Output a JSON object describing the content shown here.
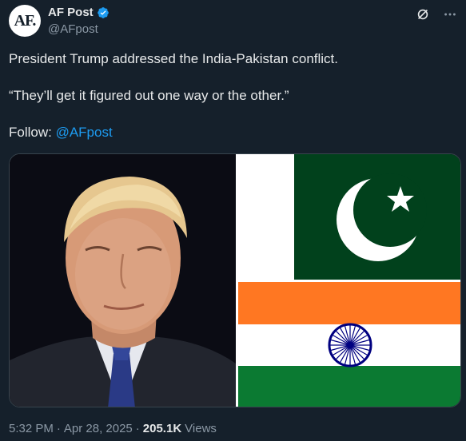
{
  "author": {
    "avatar_text": "AF.",
    "display_name": "AF Post",
    "handle": "@AFpost"
  },
  "tweet": {
    "line1": "President Trump addressed the India-Pakistan conflict.",
    "line2": "“They’ll get it figured out one way or the other.”",
    "follow_label": "Follow: ",
    "follow_mention": "@AFpost"
  },
  "meta": {
    "time": "5:32 PM",
    "separator": "·",
    "date": "Apr 28, 2025",
    "views_count": "205.1K",
    "views_label": "Views"
  },
  "colors": {
    "background": "#15202b",
    "link": "#1d9bf0",
    "verified": "#1d9bf0",
    "pakistan_green": "#01411c",
    "india_saffron": "#ff7722",
    "india_green": "#0b7a32",
    "chakra_blue": "#000080"
  },
  "icons": {
    "verified": "verified-badge-icon",
    "grok": "grok-icon",
    "more": "more-options-icon"
  }
}
